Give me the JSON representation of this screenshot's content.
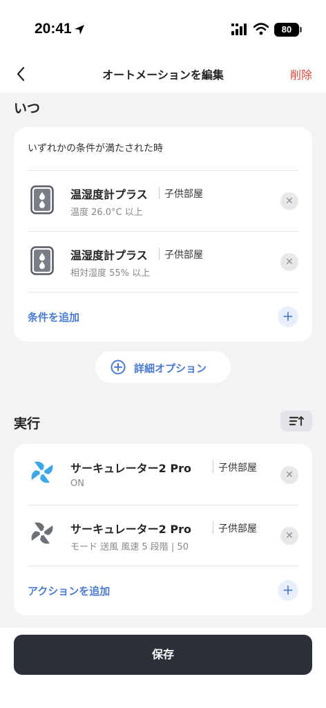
{
  "status_bar": {
    "time": "20:41",
    "battery": "80",
    "icons": [
      "location-arrow-icon",
      "signal-icon",
      "wifi-icon",
      "battery-icon"
    ]
  },
  "nav": {
    "title": "オートメーションを編集",
    "delete_label": "削除",
    "back_icon": "chevron-left-icon"
  },
  "when": {
    "section_title": "いつ",
    "header": "いずれかの条件が満たされた時",
    "conditions": [
      {
        "device": "温湿度計プラス",
        "room": "子供部屋",
        "detail": "温度 26.0°C 以上",
        "icon": "thermo-hygrometer-icon"
      },
      {
        "device": "温湿度計プラス",
        "room": "子供部屋",
        "detail": "相対湿度 55% 以上",
        "icon": "thermo-hygrometer-icon"
      }
    ],
    "add_label": "条件を追加"
  },
  "advanced_option_label": "詳細オプション",
  "actions": {
    "section_title": "実行",
    "items": [
      {
        "device": "サーキュレーター2 Pro",
        "room": "子供部屋",
        "detail": "ON",
        "icon": "fan-icon",
        "icon_color": "#3ba7e6"
      },
      {
        "device": "サーキュレーター2 Pro",
        "room": "子供部屋",
        "detail": "モード 送風 風速 5 段階 | 50",
        "icon": "fan-icon",
        "icon_color": "#6b6f76"
      }
    ],
    "add_label": "アクションを追加"
  },
  "save_label": "保存",
  "colors": {
    "accent": "#4a7bd0",
    "delete": "#d04a3c",
    "save_button": "#2c3038",
    "background": "#f2f3f5"
  }
}
